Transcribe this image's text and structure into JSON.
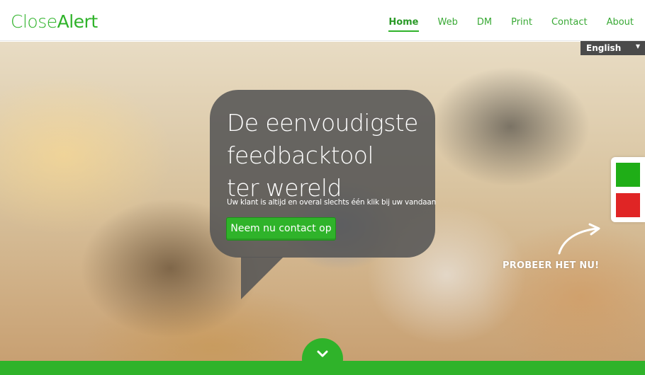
{
  "header": {
    "logo_part1": "Close",
    "logo_part2": "Alert",
    "nav": [
      {
        "label": "Home",
        "active": true
      },
      {
        "label": "Web"
      },
      {
        "label": "DM"
      },
      {
        "label": "Print"
      },
      {
        "label": "Contact"
      },
      {
        "label": "About"
      }
    ]
  },
  "language": {
    "selected": "English",
    "icon": "caret-down-icon"
  },
  "hero": {
    "headline": [
      "De eenvoudigste",
      "feedbacktool",
      "ter wereld"
    ],
    "subline": "Uw klant is altijd en overal slechts één klik bij uw vandaan",
    "cta_label": "Neem nu contact op"
  },
  "widget": {
    "try_label": "PROBEER HET NU!",
    "positive_color": "#1fae17",
    "negative_color": "#e02525"
  },
  "colors": {
    "brand": "#2fb32a",
    "dark_bubble": "#555555"
  },
  "scroll": {
    "icon": "chevron-down-icon"
  }
}
